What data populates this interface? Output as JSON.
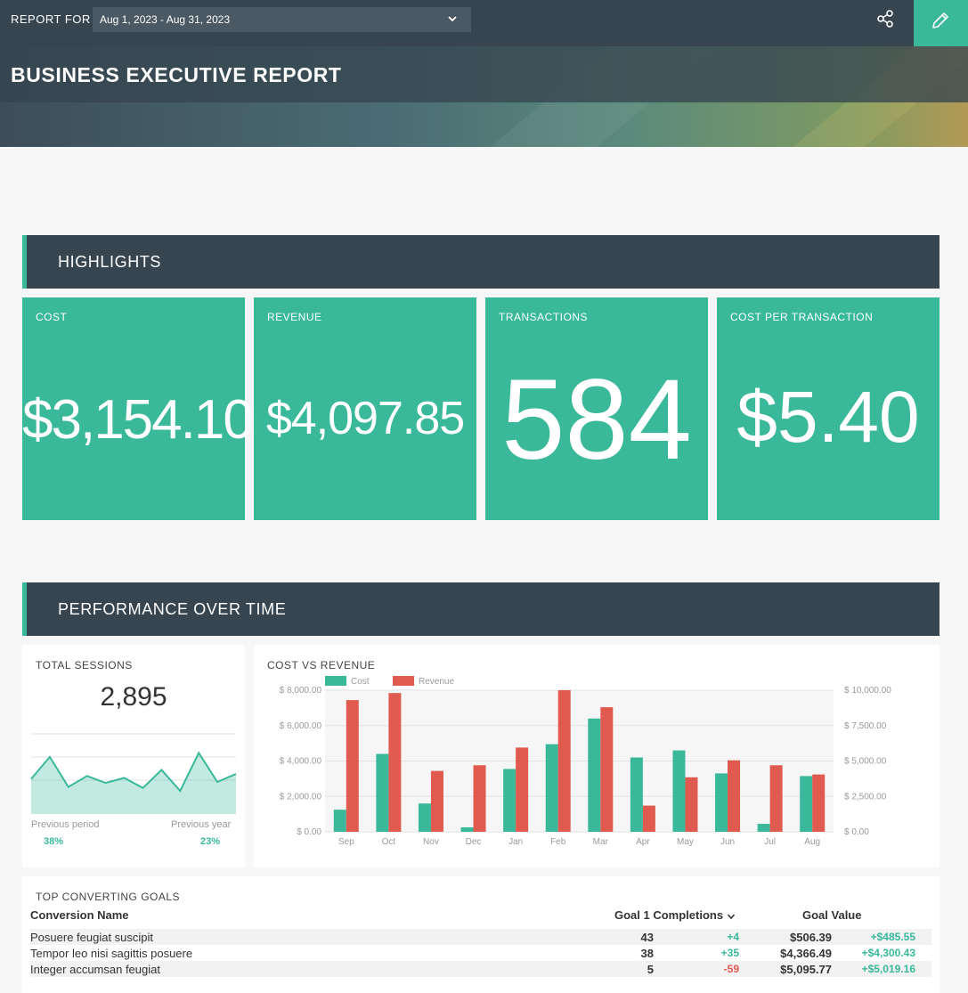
{
  "topbar": {
    "report_for_label": "REPORT FOR",
    "date_range": "Aug 1, 2023 - Aug 31, 2023"
  },
  "banner": {
    "title": "BUSINESS EXECUTIVE REPORT"
  },
  "colors": {
    "accent": "#39b89a",
    "dark": "#36454f",
    "revenue": "#e05a4f"
  },
  "highlights": {
    "section_title": "HIGHLIGHTS",
    "kpis": [
      {
        "label": "COST",
        "value": "$3,154.10"
      },
      {
        "label": "REVENUE",
        "value": "$4,097.85"
      },
      {
        "label": "TRANSACTIONS",
        "value": "584"
      },
      {
        "label": "COST PER TRANSACTION",
        "value": "$5.40"
      }
    ]
  },
  "performance": {
    "section_title": "PERFORMANCE OVER TIME",
    "sessions": {
      "title": "TOTAL SESSIONS",
      "value": "2,895",
      "previous_period_label": "Previous period",
      "previous_period_value": "38%",
      "previous_year_label": "Previous year",
      "previous_year_value": "23%"
    },
    "cost_vs_revenue": {
      "title": "COST VS REVENUE"
    }
  },
  "chart_data": [
    {
      "type": "area",
      "title": "TOTAL SESSIONS",
      "values": [
        95,
        117,
        87,
        98,
        91,
        96,
        86,
        104,
        83,
        121,
        92,
        100
      ],
      "ylim": [
        60,
        140
      ]
    },
    {
      "type": "bar",
      "title": "COST VS REVENUE",
      "categories": [
        "Sep",
        "Oct",
        "Nov",
        "Dec",
        "Jan",
        "Feb",
        "Mar",
        "Apr",
        "May",
        "Jun",
        "Jul",
        "Aug"
      ],
      "series": [
        {
          "name": "Cost",
          "axis": "left",
          "values": [
            1250,
            4400,
            1600,
            250,
            3550,
            4950,
            6400,
            4200,
            4600,
            3300,
            450,
            3150
          ]
        },
        {
          "name": "Revenue",
          "axis": "right",
          "values": [
            9300,
            9800,
            4300,
            4700,
            5950,
            10000,
            8800,
            1850,
            3850,
            5050,
            4700,
            4050
          ]
        }
      ],
      "y_left": {
        "ylim": [
          0,
          8000
        ],
        "ticks": [
          "$ 0.00",
          "$ 2,000.00",
          "$ 4,000.00",
          "$ 6,000.00",
          "$ 8,000.00"
        ]
      },
      "y_right": {
        "ylim": [
          0,
          10000
        ],
        "ticks": [
          "$ 0.00",
          "$ 2,500.00",
          "$ 5,000.00",
          "$ 7,500.00",
          "$ 10,000.00"
        ]
      },
      "legend": "top-left",
      "grid": true
    }
  ],
  "goals": {
    "title": "TOP CONVERTING GOALS",
    "headers": {
      "name": "Conversion Name",
      "completions": "Goal 1 Completions",
      "value": "Goal Value"
    },
    "rows": [
      {
        "name": "Posuere feugiat suscipit",
        "completions": "43",
        "completions_change": "+4",
        "value": "$506.39",
        "value_change": "+$485.55"
      },
      {
        "name": "Tempor leo nisi sagittis posuere",
        "completions": "38",
        "completions_change": "+35",
        "value": "$4,366.49",
        "value_change": "+$4,300.43"
      },
      {
        "name": "Integer accumsan feugiat",
        "completions": "5",
        "completions_change": "-59",
        "value": "$5,095.77",
        "value_change": "+$5,019.16"
      }
    ]
  }
}
